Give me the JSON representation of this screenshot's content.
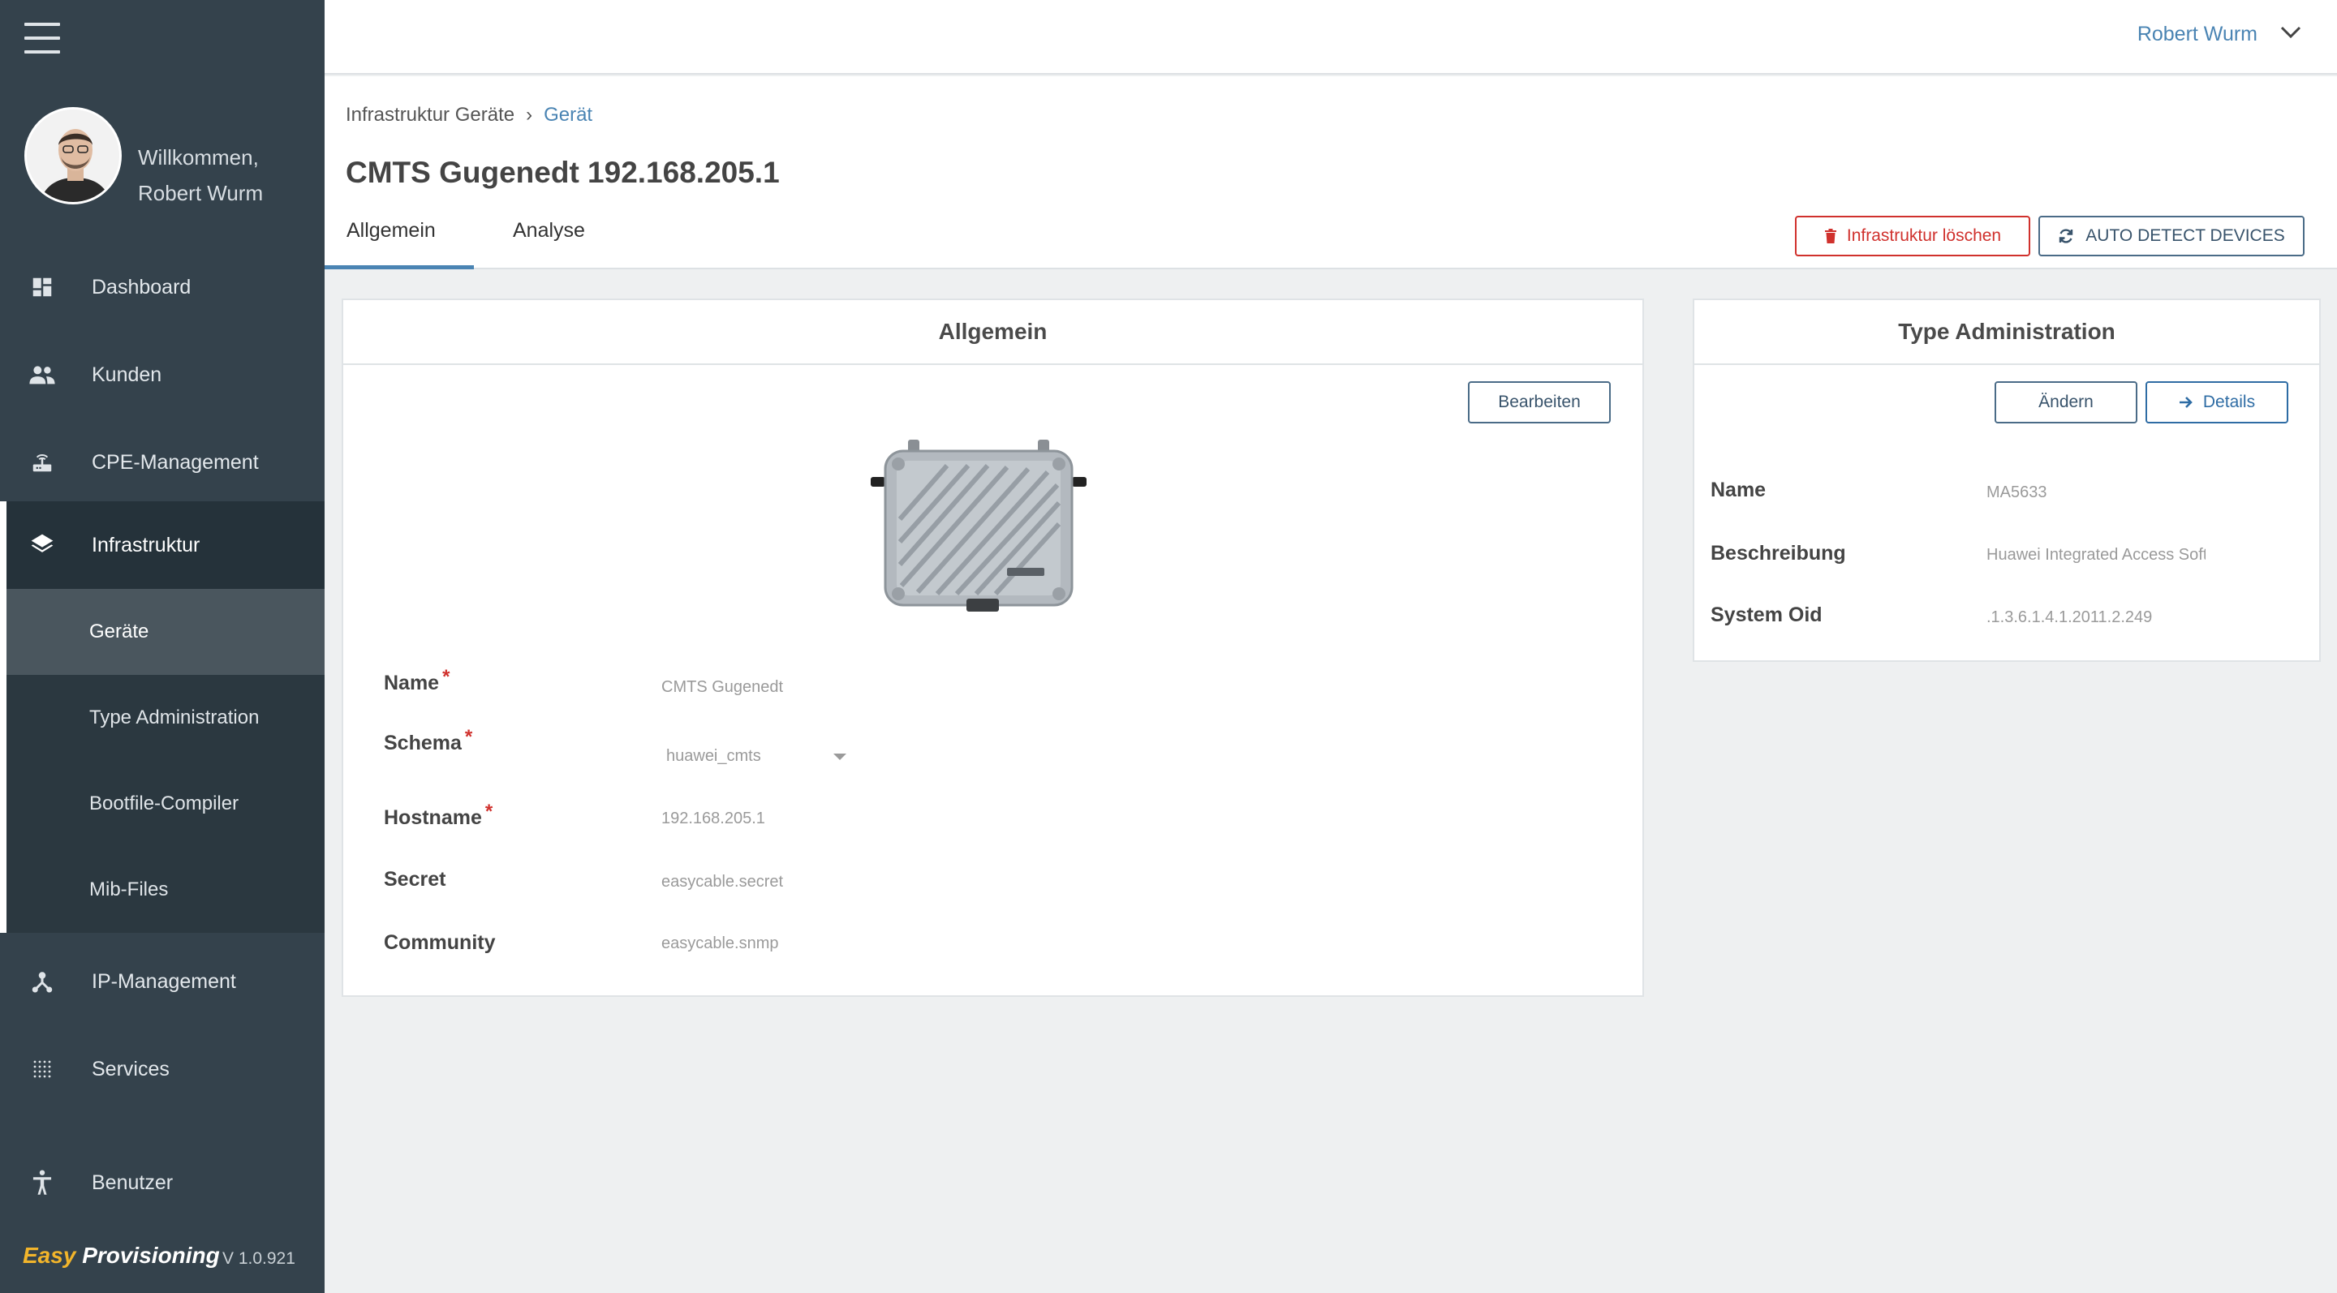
{
  "user": {
    "welcome": "Willkommen,",
    "name": "Robert Wurm"
  },
  "sidebar": {
    "items": [
      {
        "label": "Dashboard",
        "icon": "dashboard-icon"
      },
      {
        "label": "Kunden",
        "icon": "people-icon"
      },
      {
        "label": "CPE-Management",
        "icon": "router-icon"
      },
      {
        "label": "Infrastruktur",
        "icon": "layers-icon"
      },
      {
        "label": "IP-Management",
        "icon": "network-icon"
      },
      {
        "label": "Services",
        "icon": "grid-dots-icon"
      },
      {
        "label": "Benutzer",
        "icon": "accessibility-icon"
      }
    ],
    "subitems": [
      {
        "label": "Geräte"
      },
      {
        "label": "Type Administration"
      },
      {
        "label": "Bootfile-Compiler"
      },
      {
        "label": "Mib-Files"
      }
    ]
  },
  "brand": {
    "easy": "Easy",
    "provisioning": "Provisioning",
    "version": "V 1.0.921"
  },
  "breadcrumb": {
    "parent": "Infrastruktur Geräte",
    "separator": "›",
    "current": "Gerät"
  },
  "page": {
    "title": "CMTS Gugenedt 192.168.205.1"
  },
  "tabs": [
    {
      "label": "Allgemein",
      "active": true
    },
    {
      "label": "Analyse",
      "active": false
    }
  ],
  "actions": {
    "delete_label": "Infrastruktur löschen",
    "autodetect_label": "AUTO DETECT DEVICES"
  },
  "general_card": {
    "title": "Allgemein",
    "edit_label": "Bearbeiten",
    "fields": [
      {
        "label": "Name",
        "value": "CMTS Gugenedt",
        "required": true
      },
      {
        "label": "Schema",
        "value": "huawei_cmts",
        "required": true
      },
      {
        "label": "Hostname",
        "value": "192.168.205.1",
        "required": true
      },
      {
        "label": "Secret",
        "value": "easycable.secret",
        "required": false
      },
      {
        "label": "Community",
        "value": "easycable.snmp",
        "required": false
      }
    ],
    "required_mark": "*"
  },
  "type_card": {
    "title": "Type Administration",
    "change_label": "Ändern",
    "details_label": "Details",
    "fields": [
      {
        "label": "Name",
        "value": "MA5633"
      },
      {
        "label": "Beschreibung",
        "value": "Huawei Integrated Access Softw"
      },
      {
        "label": "System Oid",
        "value": ".1.3.6.1.4.1.2011.2.249"
      }
    ]
  },
  "colors": {
    "sidebar_bg": "#34424c",
    "accent": "#4a84b3",
    "danger": "#d0312d",
    "brand_yellow": "#f2b52b"
  }
}
